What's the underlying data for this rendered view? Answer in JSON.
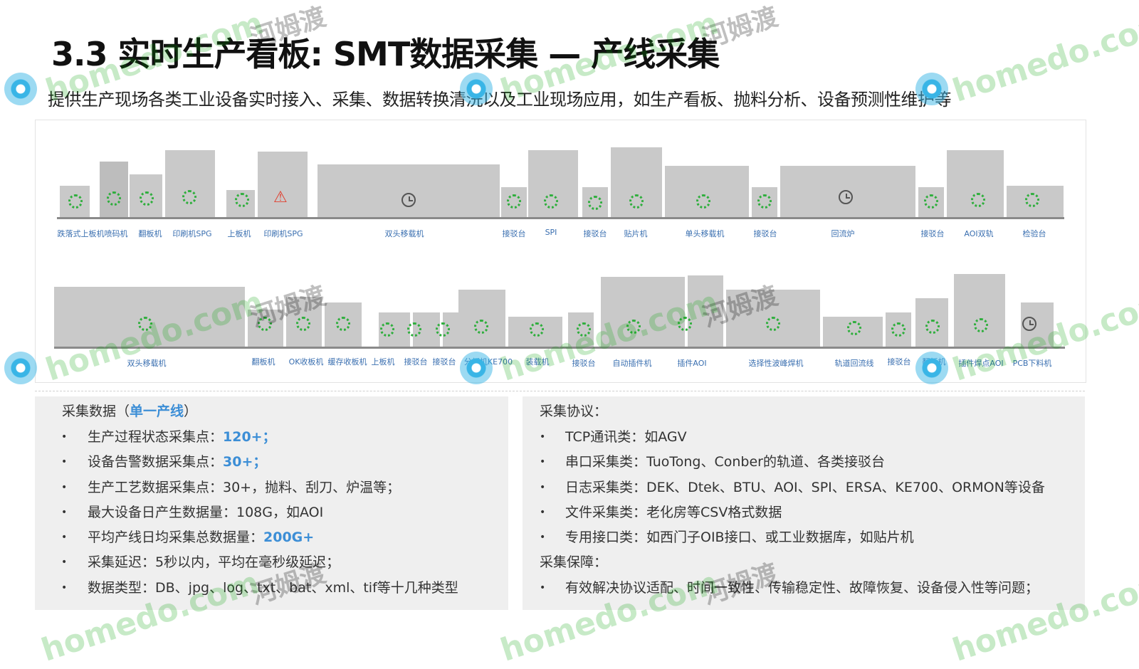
{
  "header": {
    "title": "3.3 实时生产看板: SMT数据采集 — 产线采集",
    "subtitle": "提供生产现场各类工业设备实时接入、采集、数据转换清洗以及工业现场应用，如生产看板、抛料分析、设备预测性维护等"
  },
  "diagram": {
    "row1_labels": [
      "跌落式上板机喷码机",
      "翻板机",
      "印刷机SPG",
      "上板机",
      "印刷机SPG",
      "双头移载机",
      "接驳台",
      "SPI",
      "接驳台",
      "贴片机",
      "单头移载机",
      "接驳台",
      "回流炉",
      "接驳台",
      "AOI双轨",
      "检验台"
    ],
    "row2_labels": [
      "双头移载机",
      "翻板机",
      "OK收板机",
      "缓存收板机",
      "上板机",
      "接驳台",
      "接驳台",
      "分板机KE700",
      "装载机",
      "接驳台",
      "自动插件机",
      "插件AOI",
      "选择性波峰焊机",
      "轨道回流线",
      "接驳台",
      "翻板机",
      "插件焊点AOI",
      "PCB下料机"
    ]
  },
  "left_panel": {
    "heading_prefix": "采集数据（",
    "heading_highlight": "单一产线",
    "heading_suffix": "）",
    "items": [
      {
        "text": "生产过程状态采集点：",
        "value": "120+；"
      },
      {
        "text": "设备告警数据采集点：",
        "value": "30+；"
      },
      {
        "text": "生产工艺数据采集点：30+，抛料、刮刀、炉温等；",
        "value": ""
      },
      {
        "text": "最大设备日产生数据量：108G，如AOI",
        "value": ""
      },
      {
        "text": "平均产线日均采集总数据量：",
        "value": "200G+"
      },
      {
        "text": "采集延迟：5秒以内，平均在毫秒级延迟；",
        "value": ""
      },
      {
        "text": "数据类型：DB、jpg、log、txt、bat、xml、tif等十几种类型",
        "value": ""
      }
    ]
  },
  "right_panel": {
    "heading": "采集协议：",
    "items": [
      "TCP通讯类：如AGV",
      "串口采集类：TuoTong、Conber的轨道、各类接驳台",
      "日志采集类：DEK、Dtek、BTU、AOI、SPI、ERSA、KE700、ORMON等设备",
      "文件采集类：老化房等CSV格式数据",
      "专用接口类：如西门子OIB接口、或工业数据库，如贴片机"
    ],
    "heading2": "采集保障：",
    "items2": [
      "有效解决协议适配、时间一致性、传输稳定性、故障恢复、设备侵入性等问题；"
    ]
  },
  "watermark": {
    "latin": "homedo.com",
    "cn": "河姆渡"
  },
  "colors": {
    "accent": "#3c8ed6",
    "machine": "#c9c9c9",
    "status_ok": "#2eae3c",
    "status_alarm": "#e04030",
    "panel_bg": "#efefef"
  },
  "icons": {
    "running": "dotted-spinner-icon",
    "idle": "clock-icon",
    "alarm": "warning-triangle-icon"
  }
}
